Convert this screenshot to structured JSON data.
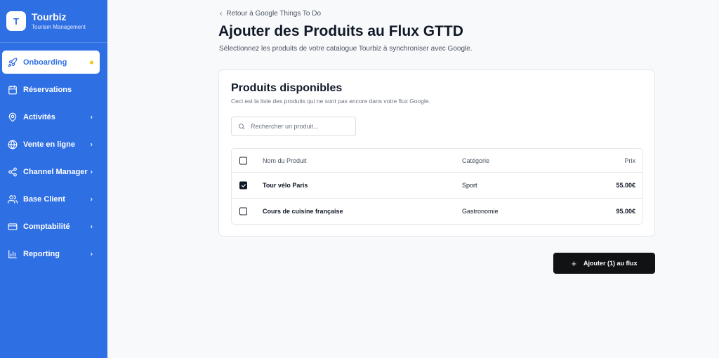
{
  "brand": {
    "logo_letter": "T",
    "name": "Tourbiz",
    "subtitle": "Tourism Management"
  },
  "sidebar": {
    "items": [
      {
        "label": "Onboarding",
        "icon": "rocket-icon",
        "active": true,
        "badge": "dot"
      },
      {
        "label": "Réservations",
        "icon": "calendar-icon",
        "active": false
      },
      {
        "label": "Activités",
        "icon": "map-pin-icon",
        "active": false,
        "chevron": true
      },
      {
        "label": "Vente en ligne",
        "icon": "globe-icon",
        "active": false,
        "chevron": true
      },
      {
        "label": "Channel Manager",
        "icon": "share-icon",
        "active": false,
        "chevron": true
      },
      {
        "label": "Base Client",
        "icon": "users-icon",
        "active": false,
        "chevron": true
      },
      {
        "label": "Comptabilité",
        "icon": "credit-card-icon",
        "active": false,
        "chevron": true
      },
      {
        "label": "Reporting",
        "icon": "bar-chart-icon",
        "active": false,
        "chevron": true
      }
    ]
  },
  "header": {
    "back_link": "Retour à Google Things To Do",
    "title": "Ajouter des Produits au Flux GTTD",
    "subtitle": "Sélectionnez les produits de votre catalogue Tourbiz à synchroniser avec Google."
  },
  "card": {
    "title": "Produits disponibles",
    "subtitle": "Ceci est la liste des produits qui ne sont pas encore dans votre flux Google.",
    "search_placeholder": "Rechercher un produit..."
  },
  "table": {
    "columns": {
      "name": "Nom du Produit",
      "category": "Catégorie",
      "price": "Prix"
    },
    "rows": [
      {
        "name": "Tour vélo Paris",
        "category": "Sport",
        "price": "55.00€",
        "checked": true
      },
      {
        "name": "Cours de cuisine française",
        "category": "Gastronomie",
        "price": "95.00€",
        "checked": false
      }
    ]
  },
  "actions": {
    "add_label": "Ajouter (1) au flux"
  },
  "colors": {
    "sidebar_bg": "#2f6fe4",
    "active_text": "#2f6fe4",
    "badge_dot": "#f5c518",
    "button_bg": "#111214"
  }
}
